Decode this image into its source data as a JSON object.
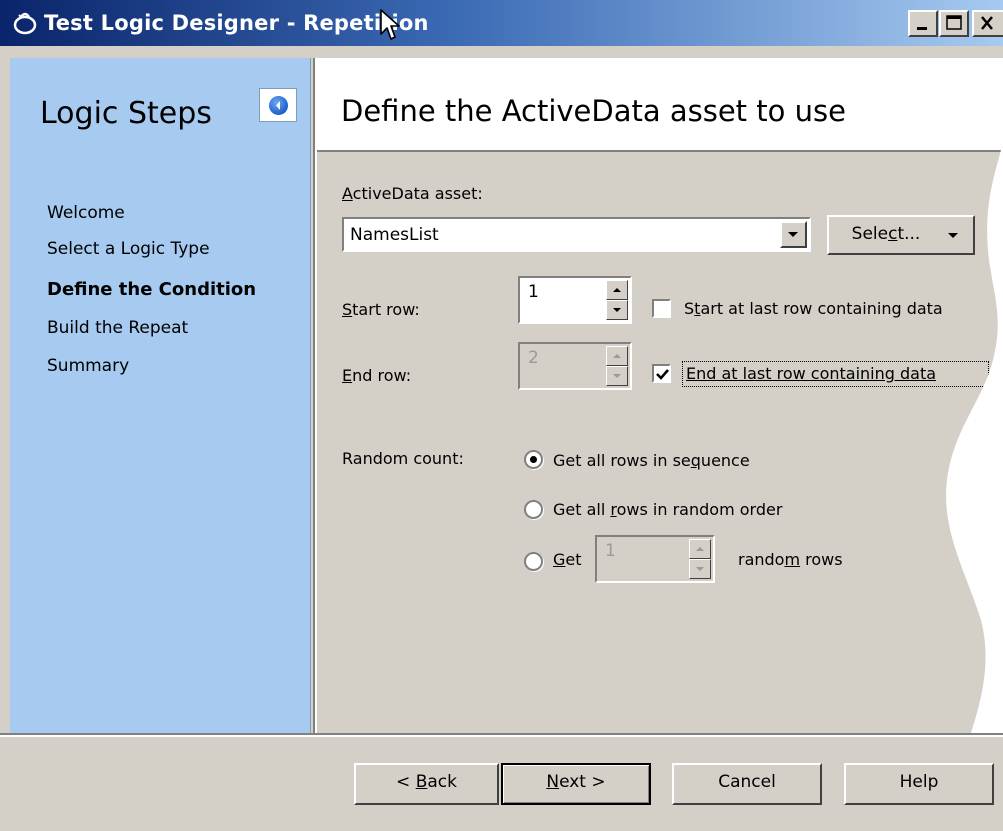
{
  "window": {
    "title": "Test Logic Designer - Repetition"
  },
  "sidebar": {
    "title": "Logic Steps",
    "collapse_icon": "chevron-left-icon",
    "steps": [
      {
        "label": "Welcome",
        "active": false
      },
      {
        "label": "Select a Logic Type",
        "active": false
      },
      {
        "label": "Define the Condition",
        "active": true
      },
      {
        "label": "Build the Repeat",
        "active": false
      },
      {
        "label": "Summary",
        "active": false
      }
    ]
  },
  "header": {
    "title": "Define the ActiveData asset to use"
  },
  "form": {
    "asset_label_mnemonic": "A",
    "asset_label_rest": "ctiveData asset:",
    "asset_value": "NamesList",
    "select_button_pre": "Sele",
    "select_button_mn": "c",
    "select_button_post": "t...",
    "start_row_label_mn": "S",
    "start_row_label_rest": "tart row:",
    "start_row_value": "1",
    "start_last_pre": "S",
    "start_last_mn": "t",
    "start_last_post": "art at last row containing data",
    "start_last_checked": false,
    "end_row_label_mn": "E",
    "end_row_label_rest": "nd row:",
    "end_row_value": "2",
    "end_last_label": "End at last row containing data",
    "end_last_checked": true,
    "random_count_label": "Random count:",
    "opt1_pre": "Get all rows in se",
    "opt1_mn": "q",
    "opt1_post": "uence",
    "opt2_pre": "Get all ",
    "opt2_mn": "r",
    "opt2_post": "ows in random order",
    "opt3_mn": "G",
    "opt3_post": "et",
    "opt3_value": "1",
    "opt3_suffix_pre": "rando",
    "opt3_suffix_mn": "m",
    "opt3_suffix_post": " rows",
    "selected_option": 1
  },
  "footer": {
    "back_pre": "< ",
    "back_mn": "B",
    "back_post": "ack",
    "next_mn": "N",
    "next_post": "ext >",
    "cancel": "Cancel",
    "help": "Help"
  },
  "colors": {
    "sidebar_bg": "#a6caf0",
    "titlebar_start": "#0a246a",
    "titlebar_end": "#a6caf0",
    "face": "#d4d0c8"
  }
}
